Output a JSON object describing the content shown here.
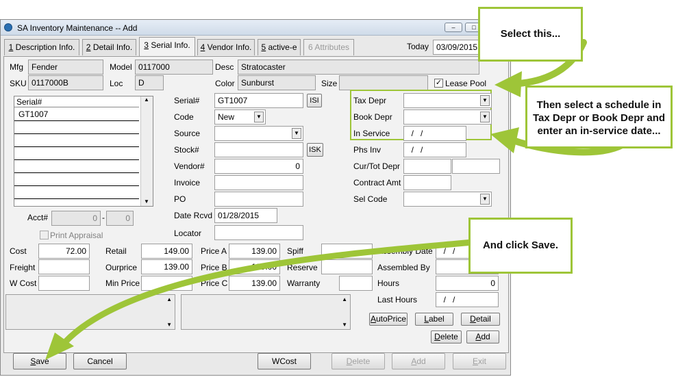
{
  "window": {
    "title": "SA Inventory Maintenance -- Add",
    "controls": [
      "–",
      "□"
    ]
  },
  "tabs": [
    {
      "num": "1",
      "label": " Description Info."
    },
    {
      "num": "2",
      "label": " Detail Info."
    },
    {
      "num": "3",
      "label": " Serial Info."
    },
    {
      "num": "4",
      "label": " Vendor Info."
    },
    {
      "num": "5",
      "label": " active-e"
    },
    {
      "num": "",
      "label": "6 Attributes"
    }
  ],
  "today": {
    "label": "Today",
    "value": "03/09/2015"
  },
  "header_fields": {
    "mfg": {
      "label": "Mfg",
      "value": "Fender"
    },
    "model": {
      "label": "Model",
      "value": "0117000"
    },
    "desc": {
      "label": "Desc",
      "value": "Stratocaster"
    },
    "sku": {
      "label": "SKU",
      "value": "0117000B"
    },
    "loc": {
      "label": "Loc",
      "value": "D"
    },
    "color": {
      "label": "Color",
      "value": "Sunburst"
    },
    "size": {
      "label": "Size",
      "value": ""
    },
    "lease_pool": {
      "label": "Lease Pool",
      "checked": "✓"
    }
  },
  "serial_grid": {
    "header": "Serial#",
    "rows": [
      "GT1007",
      "",
      "",
      "",
      "",
      "",
      ""
    ]
  },
  "acct": {
    "label": "Acct#",
    "value1": "0",
    "sep": "-",
    "value2": "0"
  },
  "print_appraisal": {
    "label": "Print Appraisal"
  },
  "serial_form": {
    "serial": {
      "label": "Serial#",
      "value": "GT1007",
      "btn": "ISI"
    },
    "code": {
      "label": "Code",
      "value": "New"
    },
    "source": {
      "label": "Source",
      "value": ""
    },
    "stock": {
      "label": "Stock#",
      "value": "",
      "btn": "ISK"
    },
    "vendor": {
      "label": "Vendor#",
      "value": "0"
    },
    "invoice": {
      "label": "Invoice",
      "value": ""
    },
    "po": {
      "label": "PO",
      "value": ""
    },
    "date_rcvd": {
      "label": "Date Rcvd",
      "value": "01/28/2015"
    },
    "locator": {
      "label": "Locator",
      "value": ""
    }
  },
  "depr": {
    "tax": {
      "label": "Tax Depr",
      "value": ""
    },
    "book": {
      "label": "Book Depr",
      "value": ""
    },
    "in_service": {
      "label": "In Service",
      "value": "  /   /"
    },
    "phs_inv": {
      "label": "Phs Inv",
      "value": "  /   /"
    },
    "cur_tot": {
      "label": "Cur/Tot Depr",
      "value1": "",
      "value2": ""
    },
    "contract_amt": {
      "label": "Contract Amt",
      "value": ""
    },
    "sel_code": {
      "label": "Sel Code",
      "value": ""
    }
  },
  "pricing": {
    "cost": {
      "label": "Cost",
      "value": "72.00"
    },
    "freight": {
      "label": "Freight",
      "value": ""
    },
    "wcost": {
      "label": "W Cost",
      "value": ""
    },
    "retail": {
      "label": "Retail",
      "value": "149.00"
    },
    "ourprice": {
      "label": "Ourprice",
      "value": "139.00"
    },
    "min_price": {
      "label": "Min Price",
      "value": ""
    },
    "price_a": {
      "label": "Price A",
      "value": "139.00"
    },
    "price_b": {
      "label": "Price B",
      "value": "139.00"
    },
    "price_c": {
      "label": "Price C",
      "value": "139.00"
    },
    "spiff": {
      "label": "Spiff",
      "value": ""
    },
    "reserve": {
      "label": "Reserve",
      "value": ""
    },
    "warranty": {
      "label": "Warranty",
      "value": ""
    },
    "assembly_date": {
      "label": "Assembly Date",
      "value": "  /   /"
    },
    "assembled_by": {
      "label": "Assembled By",
      "value": ""
    },
    "hours": {
      "label": "Hours",
      "value": "0"
    },
    "last_hours": {
      "label": "Last Hours",
      "value": "  /   /"
    }
  },
  "side_buttons": {
    "autoprice": {
      "u": "A",
      "rest": "utoPrice"
    },
    "label": {
      "u": "L",
      "rest": "abel"
    },
    "detail": {
      "u": "D",
      "rest": "etail"
    },
    "delete": {
      "u": "D",
      "rest": "elete"
    },
    "add": {
      "u": "A",
      "rest": "dd"
    }
  },
  "bottom_buttons": {
    "save": {
      "u": "S",
      "rest": "ave"
    },
    "cancel": {
      "label": "Cancel"
    },
    "wcost": {
      "label": "WCost"
    },
    "delete": {
      "u": "D",
      "rest": "elete"
    },
    "add": {
      "u": "A",
      "rest": "dd"
    },
    "exit": {
      "u": "E",
      "rest": "xit"
    }
  },
  "callouts": {
    "one": "Select this...",
    "two": "Then select a schedule in Tax Depr or Book Depr and enter an in-service date...",
    "three": "And click Save."
  },
  "colors": {
    "callout_border": "#9ec538",
    "arrow": "#9ec538"
  }
}
